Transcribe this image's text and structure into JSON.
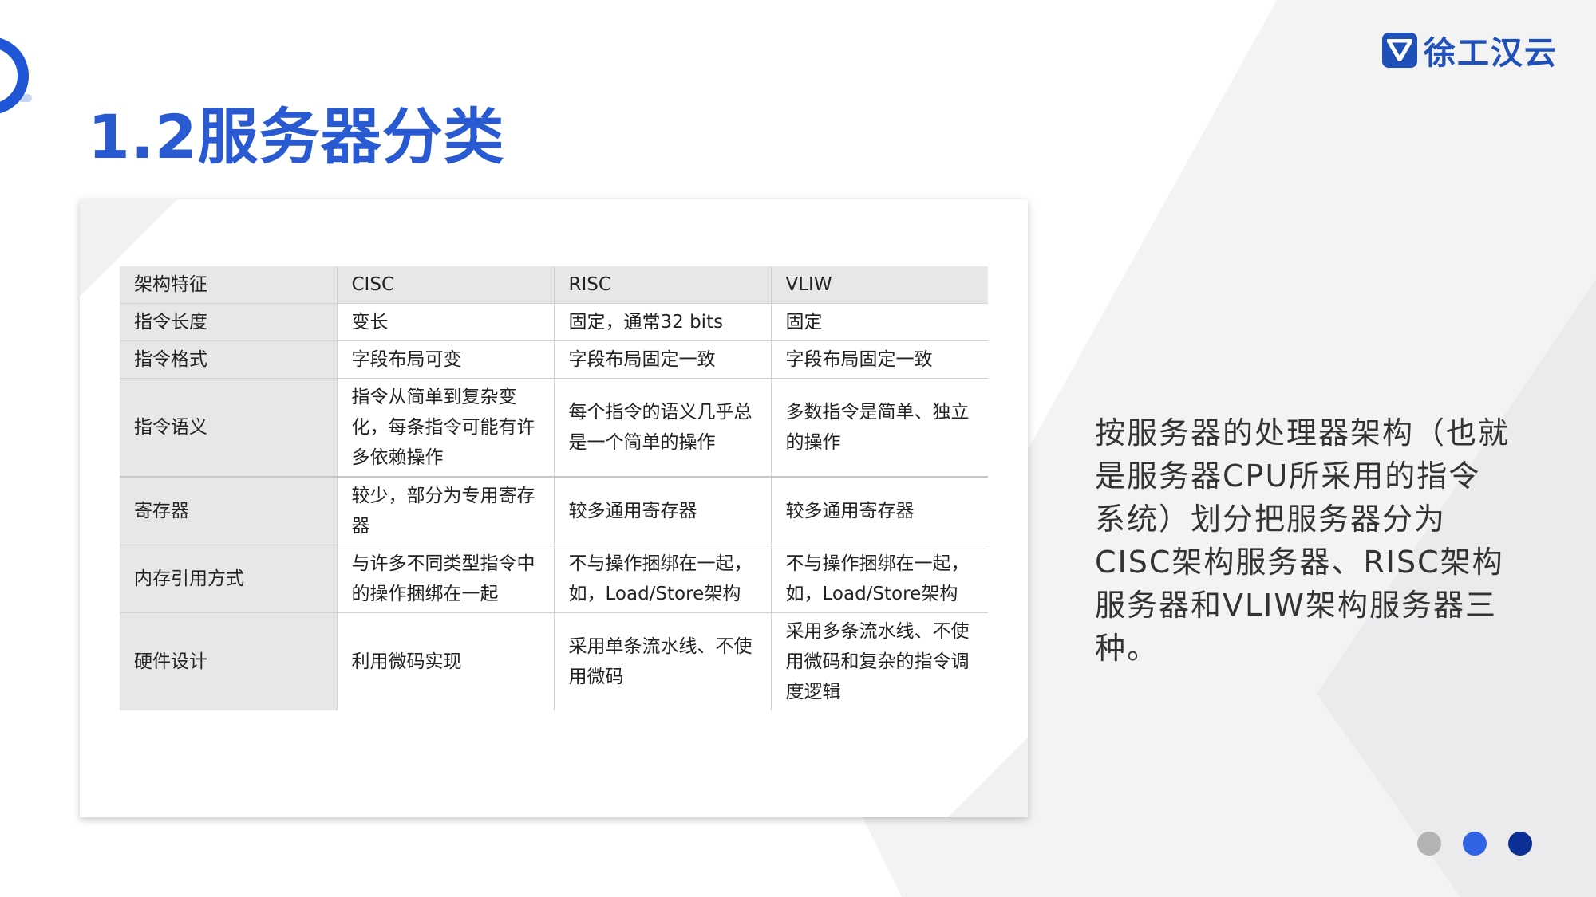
{
  "header": {
    "title": "1.2服务器分类",
    "logo_text": "徐工汉云"
  },
  "table": {
    "columns": [
      "架构特征",
      "CISC",
      "RISC",
      "VLIW"
    ],
    "rows": [
      [
        "指令长度",
        "变长",
        "固定，通常32 bits",
        "固定"
      ],
      [
        "指令格式",
        "字段布局可变",
        "字段布局固定一致",
        "字段布局固定一致"
      ],
      [
        "指令语义",
        "指令从简单到复杂变化，每条指令可能有许多依赖操作",
        "每个指令的语义几乎总是一个简单的操作",
        "多数指令是简单、独立的操作"
      ],
      [
        "寄存器",
        "较少，部分为专用寄存器",
        "较多通用寄存器",
        "较多通用寄存器"
      ],
      [
        "内存引用方式",
        "与许多不同类型指令中的操作捆绑在一起",
        "不与操作捆绑在一起，如，Load/Store架构",
        "不与操作捆绑在一起，如，Load/Store架构"
      ],
      [
        "硬件设计",
        "利用微码实现",
        "采用单条流水线、不使用微码",
        "采用多条流水线、不使用微码和复杂的指令调度逻辑"
      ]
    ]
  },
  "description": "按服务器的处理器架构（也就是服务器CPU所采用的指令系统）划分把服务器分为CISC架构服务器、RISC架构服务器和VLIW架构服务器三种。",
  "colors": {
    "title": "#2a5ad2",
    "accent": "#1f56d6",
    "logo": "#1f4fb8",
    "dots": [
      "#b3b3b3",
      "#2f63e3",
      "#0b2f95"
    ]
  },
  "icons": {
    "logo": "shield-v-logo-icon",
    "corner": "ring-decoration-icon"
  }
}
